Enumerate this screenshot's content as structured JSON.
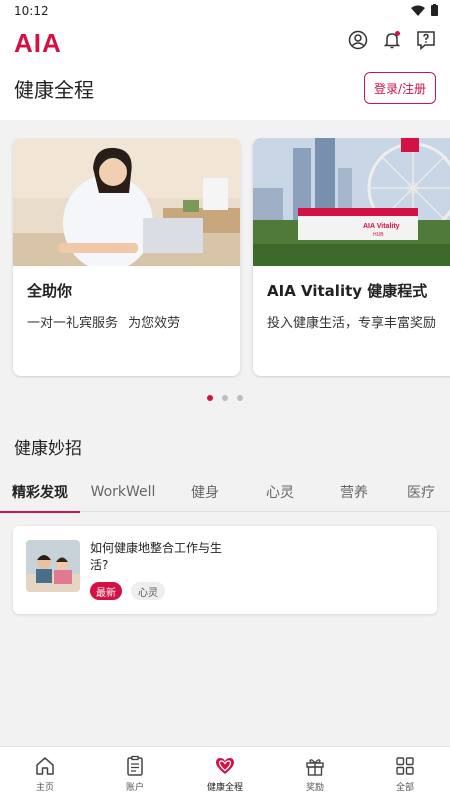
{
  "status": {
    "time": "10:12"
  },
  "header": {
    "logo": "AIA",
    "page_title": "健康全程",
    "login_label": "登录/注册",
    "icons": [
      "profile-icon",
      "bell-icon",
      "help-icon"
    ]
  },
  "carousel": {
    "cards": [
      {
        "title": "全助你",
        "subtitle": "一对一礼宾服务 为您效劳"
      },
      {
        "title": "AIA Vitality 健康程式",
        "subtitle": "投入健康生活，专享丰富奖励",
        "image_sign": "AIA Vitality HUB"
      }
    ],
    "page_count": 3,
    "active_index": 0
  },
  "section": {
    "title": "健康妙招"
  },
  "tabs": [
    {
      "label": "精彩发现",
      "active": true
    },
    {
      "label": "WorkWell",
      "active": false
    },
    {
      "label": "健身",
      "active": false
    },
    {
      "label": "心灵",
      "active": false
    },
    {
      "label": "营养",
      "active": false
    },
    {
      "label": "医疗",
      "active": false
    }
  ],
  "article": {
    "title": "如何健康地整合工作与生活?",
    "tag_new": "最新",
    "tag_category": "心灵"
  },
  "bottom_nav": [
    {
      "label": "主页",
      "icon": "home-icon",
      "active": false
    },
    {
      "label": "账户",
      "icon": "document-icon",
      "active": false
    },
    {
      "label": "健康全程",
      "icon": "heart-icon",
      "active": true
    },
    {
      "label": "奖励",
      "icon": "gift-icon",
      "active": false
    },
    {
      "label": "全部",
      "icon": "grid-icon",
      "active": false
    }
  ],
  "colors": {
    "brand": "#d31145",
    "background": "#f2f2f2"
  }
}
